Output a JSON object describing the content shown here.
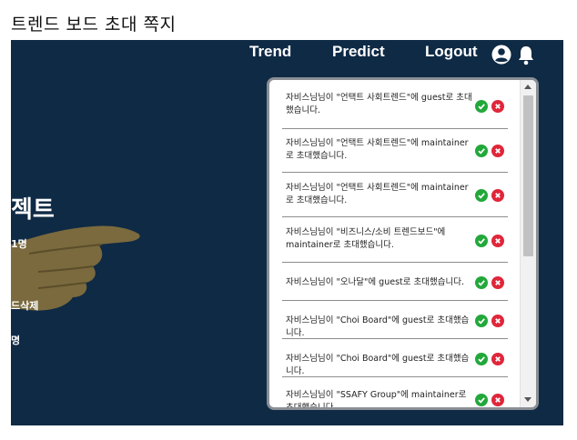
{
  "caption": "트렌드 보드 초대 쪽지",
  "nav": {
    "trend": "Trend",
    "predict": "Predict",
    "logout": "Logout",
    "profile_icon": "user-circle-icon",
    "bell_icon": "bell-icon"
  },
  "background": {
    "title": "젝트",
    "line1": "1명",
    "line2": "드삭제",
    "line3": "명"
  },
  "invites": [
    {
      "message": "자비스님님이 \"언택트 사회트렌드\"에 guest로 초대했습니다."
    },
    {
      "message": "자비스님님이 \"언택트 사회트렌드\"에 maintainer로 초대했습니다."
    },
    {
      "message": "자비스님님이 \"언택트 사회트렌드\"에 maintainer로 초대했습니다."
    },
    {
      "message": "자비스님님이 \"비즈니스/소비 트렌드보드\"에 maintainer로 초대했습니다."
    },
    {
      "message": "자비스님님이 \"오나달\"에 guest로 초대했습니다."
    },
    {
      "message": "자비스님님이 \"Choi Board\"에 guest로 초대했습니다."
    },
    {
      "message": "자비스님님이 \"Choi Board\"에 guest로 초대했습니다."
    },
    {
      "message": "자비스님님이 \"SSAFY Group\"에 maintainer로 초대했습니다."
    }
  ],
  "colors": {
    "accept": "#22a83a",
    "reject": "#e0263a",
    "background": "#0f2a45"
  }
}
